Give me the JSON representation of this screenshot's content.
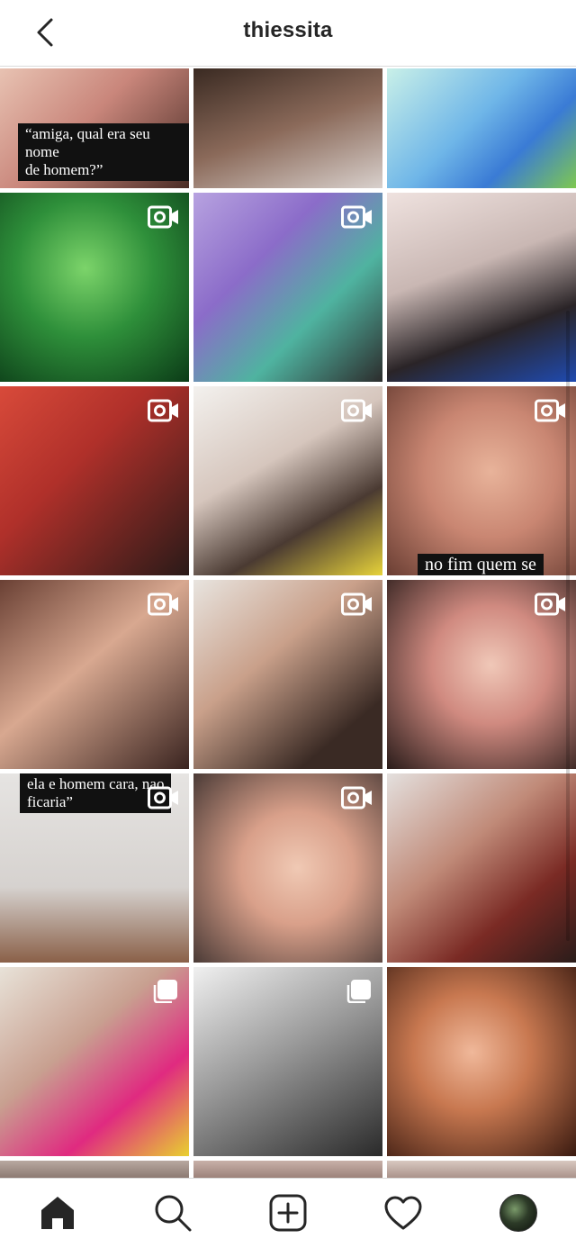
{
  "header": {
    "username": "thiessita",
    "back_icon": "chevron-left-icon"
  },
  "tiles": [
    {
      "type": "photo",
      "caption": "“amiga, qual era seu nome\nde homem?”",
      "bg": "linear-gradient(135deg,#e8c2b2 0%,#c9867b 45%,#4a2c25 100%)"
    },
    {
      "type": "photo",
      "caption": "",
      "bg": "linear-gradient(160deg,#3a2a22 0%,#8b6a5a 50%,#d8d0cc 100%)"
    },
    {
      "type": "photo",
      "caption": "",
      "bg": "linear-gradient(135deg,#c9f0e8 0%,#6fb6e8 45%,#3a7bd5 70%,#7ec850 100%)"
    },
    {
      "type": "video",
      "caption": "",
      "bg": "radial-gradient(circle at 45% 40%,#7cd46a 0%,#2e8f3a 45%,#0b3b17 100%)"
    },
    {
      "type": "video",
      "caption": "",
      "bg": "linear-gradient(135deg,#b7a2e0 0%,#8b6cc9 35%,#4fb3a0 65%,#2c2c2c 100%)"
    },
    {
      "type": "photo",
      "caption": "",
      "bg": "linear-gradient(160deg,#efe2df 0%,#c9b7b3 40%,#2a2427 70%,#1f4ab0 100%)"
    },
    {
      "type": "video",
      "caption": "",
      "bg": "linear-gradient(135deg,#d84a3a 0%,#b0302a 40%,#2a1a18 100%)"
    },
    {
      "type": "video",
      "caption": "",
      "bg": "linear-gradient(150deg,#f3f1ee 0%,#d6c6bd 40%,#4a3a32 70%,#e6d23a 100%)"
    },
    {
      "type": "video",
      "caption": "no fim quem se",
      "bg": "radial-gradient(circle at 55% 45%,#e8b39a 0%,#c98672 45%,#6a3e33 100%)"
    },
    {
      "type": "video",
      "caption": "",
      "bg": "linear-gradient(140deg,#6a4034 0%,#d8a890 45%,#3a2420 100%)"
    },
    {
      "type": "video",
      "caption": "",
      "bg": "linear-gradient(140deg,#e8e4df 0%,#c9a08a 40%,#3a2a24 80%)"
    },
    {
      "type": "video",
      "caption": "",
      "bg": "radial-gradient(circle at 55% 45%,#f0c8b8 0%,#d08a80 40%,#2a1c1a 100%)"
    },
    {
      "type": "video",
      "caption": "ela e homem cara, nao\nficaria”",
      "bg": "linear-gradient(180deg,#e6e4e2 0%,#d6d2cf 60%,#8a6048 100%)"
    },
    {
      "type": "video",
      "caption": "",
      "bg": "radial-gradient(circle at 55% 50%,#f0c9b4 0%,#d9a08a 40%,#4a3a36 100%)"
    },
    {
      "type": "photo",
      "caption": "",
      "bg": "linear-gradient(140deg,#e4e0de 0%,#c08a78 40%,#7a2a24 70%,#2a1c1a 100%)"
    },
    {
      "type": "carousel",
      "caption": "",
      "bg": "linear-gradient(140deg,#e8e2d8 0%,#c8a090 40%,#e02a80 70%,#e8d030 100%)"
    },
    {
      "type": "carousel",
      "caption": "",
      "bg": "linear-gradient(150deg,#f0f0f0 0%,#9a9a9a 45%,#2a2a2a 100%)"
    },
    {
      "type": "photo",
      "caption": "",
      "bg": "radial-gradient(circle at 45% 45%,#f0b89a 0%,#c87850 40%,#3a1a10 100%)"
    },
    {
      "type": "photo",
      "caption": "",
      "bg": "linear-gradient(180deg,#b8a8a0 0%,#8a7870 100%)"
    },
    {
      "type": "photo",
      "caption": "",
      "bg": "linear-gradient(180deg,#c8b0a8 0%,#9a8078 100%)"
    },
    {
      "type": "photo",
      "caption": "",
      "bg": "linear-gradient(180deg,#d8c8c0 0%,#a89088 100%)"
    }
  ],
  "tabbar": {
    "items": [
      {
        "name": "home",
        "icon": "home-icon"
      },
      {
        "name": "search",
        "icon": "search-icon"
      },
      {
        "name": "new-post",
        "icon": "plus-square-icon"
      },
      {
        "name": "activity",
        "icon": "heart-icon"
      },
      {
        "name": "profile",
        "icon": "avatar-icon"
      }
    ]
  },
  "colors": {
    "text": "#262626",
    "divider": "#dbdbdb",
    "background": "#ffffff"
  }
}
